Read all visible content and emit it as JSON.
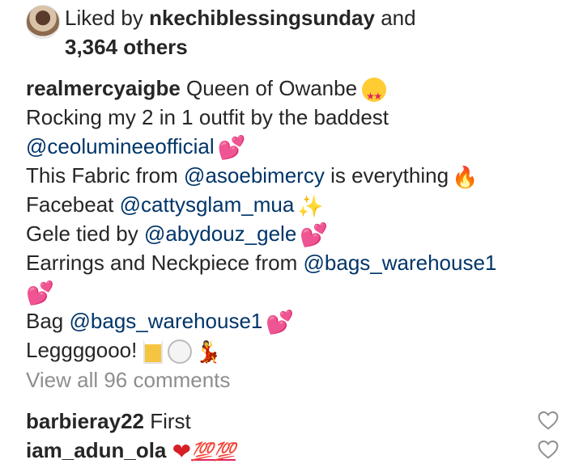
{
  "likes": {
    "prefix": "Liked by",
    "user": "nkechiblessingsunday",
    "conj": "and",
    "others": "3,364 others"
  },
  "caption": {
    "author": "realmercyaigbe",
    "title": "Queen of Owanbe",
    "line2": "Rocking my 2 in 1 outfit by the baddest",
    "mention1": "@ceolumineeofficial",
    "line4a": "This Fabric from",
    "mention2": "@asoebimercy",
    "line4b": "is everything",
    "line5a": "Facebeat",
    "mention3": "@cattysglam_mua",
    "line6a": "Gele tied by",
    "mention4": "@abydouz_gele",
    "line7a": "Earrings and Neckpiece from",
    "mention5": "@bags_warehouse1",
    "line8a": "Bag",
    "mention6": "@bags_warehouse1",
    "line9": "Leggggooo!"
  },
  "emojis": {
    "two_hearts": "💕",
    "fire": "🔥",
    "sparkles": "✨",
    "heart": "❤",
    "hundred": "💯💯",
    "dancer": "💃"
  },
  "view_all": "View all 96 comments",
  "comments": [
    {
      "user": "barbieray22",
      "text": "First"
    },
    {
      "user": "iam_adun_ola",
      "text": ""
    }
  ],
  "icons": {
    "avatar": "profile-photo",
    "like": "heart-outline-icon"
  },
  "colors": {
    "text": "#262626",
    "mention": "#003569",
    "muted": "#8e8e8e",
    "heart": "#e0245e"
  }
}
